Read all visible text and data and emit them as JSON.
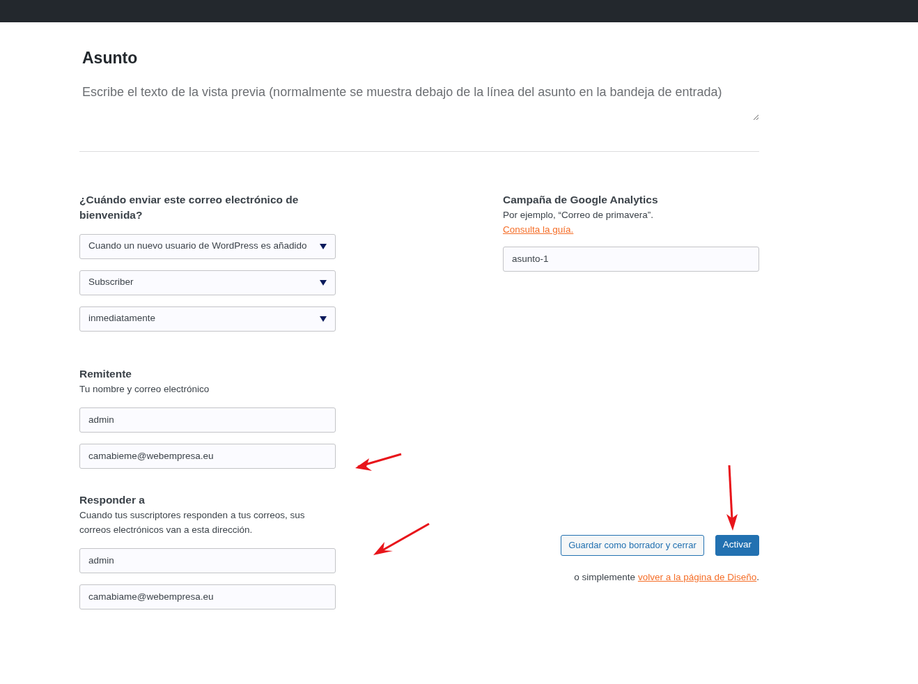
{
  "subject": {
    "title": "Asunto",
    "preview_placeholder": "Escribe el texto de la vista previa (normalmente se muestra debajo de la línea del asunto en la bandeja de entrada)"
  },
  "when": {
    "label": "¿Cuándo enviar este correo electrónico de bienvenida?",
    "selects": [
      "Cuando un nuevo usuario de WordPress es añadido",
      "Subscriber",
      "inmediatamente"
    ]
  },
  "sender": {
    "label": "Remitente",
    "hint": "Tu nombre y correo electrónico",
    "fields": [
      "admin",
      "camabieme@webempresa.eu"
    ]
  },
  "reply_to": {
    "label": "Responder a",
    "hint": "Cuando tus suscriptores responden a tus correos, sus correos electrónicos van a esta dirección.",
    "fields": [
      "admin",
      "camabiame@webempresa.eu"
    ]
  },
  "analytics": {
    "label": "Campaña de Google Analytics",
    "hint": "Por ejemplo, “Correo de primavera”.",
    "link": "Consulta la guía.",
    "value": "asunto-1"
  },
  "actions": {
    "buttons": [
      {
        "label": "Guardar como borrador y cerrar",
        "kind": "secondary"
      },
      {
        "label": "Activar",
        "kind": "primary"
      }
    ],
    "footer_prefix": "o simplemente",
    "footer_link": "volver a la página de Diseño",
    "footer_suffix": "."
  }
}
